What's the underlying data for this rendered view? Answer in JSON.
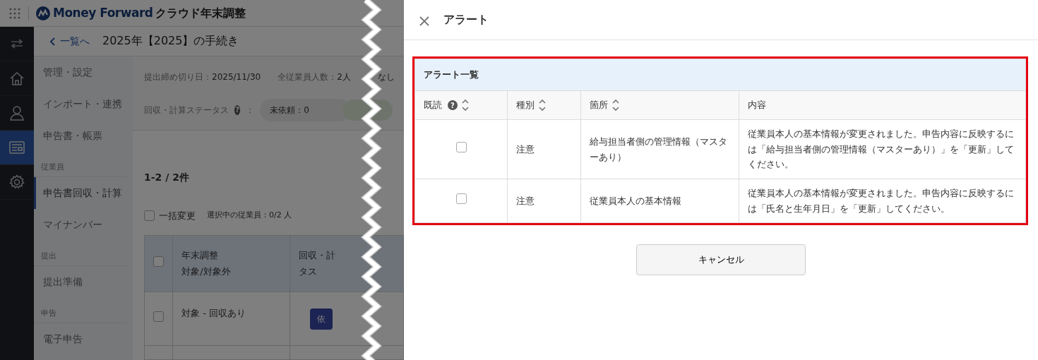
{
  "app": {
    "brand": "Money Forward",
    "product": "クラウド年末調整",
    "back_link": "一覧へ",
    "page_title": "2025年【2025】の手続き",
    "rail": [
      {
        "kind": "switch",
        "selected": false
      },
      {
        "kind": "home",
        "selected": false
      },
      {
        "kind": "person",
        "selected": false
      },
      {
        "kind": "document",
        "selected": true
      },
      {
        "kind": "gear",
        "selected": false
      }
    ],
    "nav": [
      {
        "kind": "item",
        "label": "管理・設定",
        "selected": false
      },
      {
        "kind": "item",
        "label": "インポート・連携",
        "selected": false
      },
      {
        "kind": "item",
        "label": "申告書・帳票",
        "selected": false
      },
      {
        "kind": "section",
        "label": "従業員"
      },
      {
        "kind": "item",
        "label": "申告書回収・計算",
        "selected": true
      },
      {
        "kind": "item",
        "label": "マイナンバー",
        "selected": false
      },
      {
        "kind": "section",
        "label": "提出"
      },
      {
        "kind": "item",
        "label": "提出準備",
        "selected": false
      },
      {
        "kind": "section",
        "label": "申告"
      },
      {
        "kind": "item",
        "label": "電子申告",
        "selected": false
      }
    ],
    "summary": {
      "deadline_label": "提出締め切り日：",
      "deadline": "2025/11/30",
      "staff_label": "全従業員人数：",
      "staff": "2人",
      "extra": "なし",
      "status_label": "回収・計算ステータス",
      "help": "?",
      "status_sep": "：",
      "status_pill": "未依頼：0"
    },
    "count": "1-2 / 2件",
    "bulk": {
      "label": "一括変更",
      "checked": false
    },
    "selected_info": "選択中の従業員：0/2 人",
    "table": {
      "select_all": false,
      "columns": [
        [
          "年末調整",
          "対象/対象外"
        ],
        [
          "回収・計",
          "タス"
        ]
      ],
      "rows": [
        {
          "checked": false,
          "target": "対象 - 回収あり",
          "action": "依"
        }
      ]
    }
  },
  "panel": {
    "title": "アラート",
    "card_title": "アラート一覧",
    "highlighted": true,
    "columns": [
      {
        "label": "既読",
        "help": "?",
        "sortable": true
      },
      {
        "label": "種別",
        "sortable": true
      },
      {
        "label": "箇所",
        "sortable": true
      },
      {
        "label": "内容",
        "sortable": false
      }
    ],
    "rows": [
      {
        "read": false,
        "type": "注意",
        "place": "給与担当者側の管理情報（マスターあり）",
        "content": "従業員本人の基本情報が変更されました。申告内容に反映するには「給与担当者側の管理情報（マスターあり）」を「更新」してください。"
      },
      {
        "read": false,
        "type": "注意",
        "place": "従業員本人の基本情報",
        "content": "従業員本人の基本情報が変更されました。申告内容に反映するには「氏名と生年月日」を「更新」してください。"
      }
    ],
    "cancel": "キャンセル"
  }
}
